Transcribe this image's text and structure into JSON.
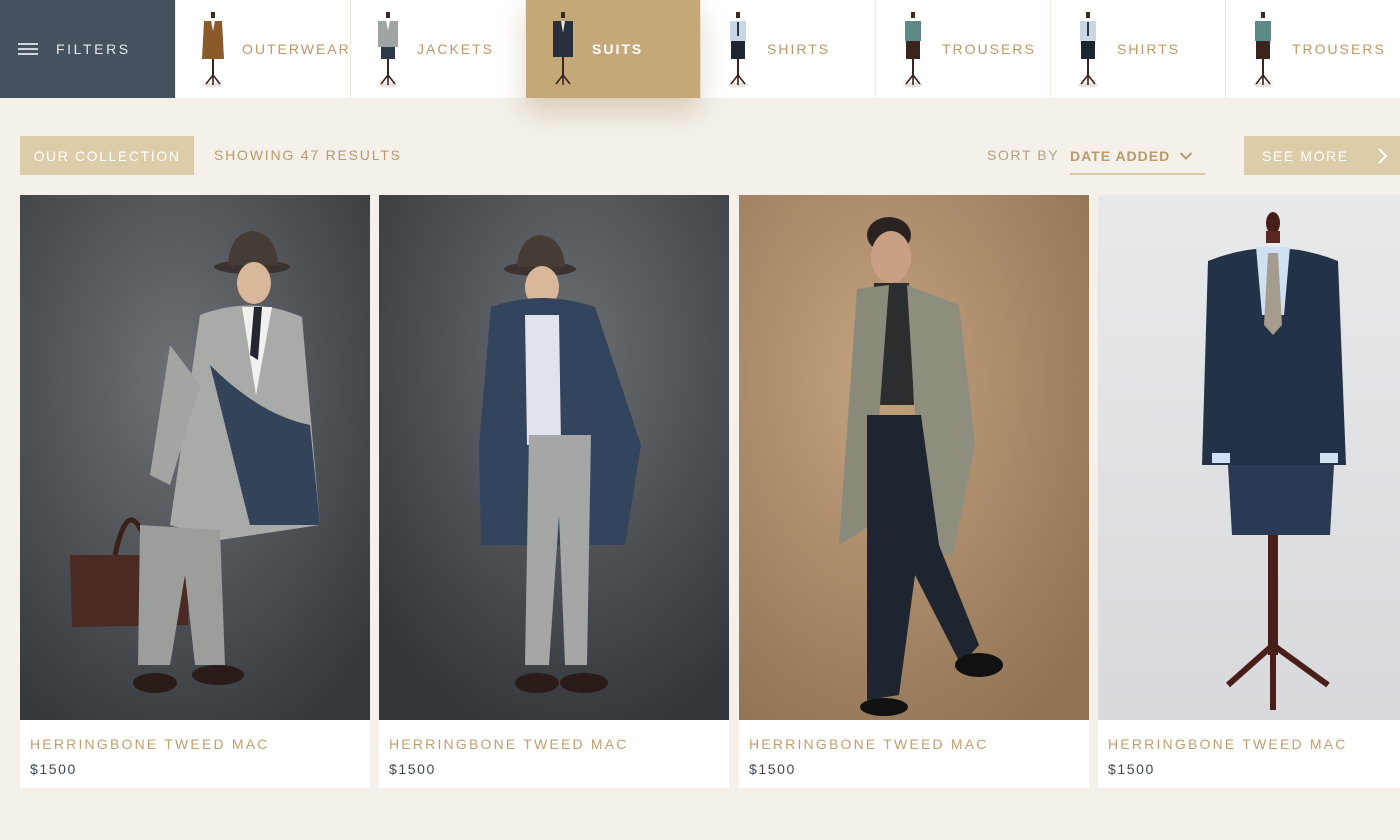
{
  "filters": {
    "label": "FILTERS",
    "icon": "filters-sliders-icon"
  },
  "categories": [
    {
      "label": "OUTERWEAR",
      "active": false
    },
    {
      "label": "JACKETS",
      "active": false
    },
    {
      "label": "SUITS",
      "active": true
    },
    {
      "label": "SHIRTS",
      "active": false
    },
    {
      "label": "TROUSERS",
      "active": false
    },
    {
      "label": "SHIRTS",
      "active": false
    },
    {
      "label": "TROUSERS",
      "active": false
    }
  ],
  "toolbar": {
    "collection_label": "OUR COLLECTION",
    "results_text": "SHOWING 47 RESULTS",
    "sort_label": "SORT BY",
    "sort_value": "DATE ADDED",
    "see_more_label": "SEE MORE"
  },
  "products": [
    {
      "title": "HERRINGBONE TWEED MAC",
      "price": "$1500"
    },
    {
      "title": "HERRINGBONE TWEED MAC",
      "price": "$1500"
    },
    {
      "title": "HERRINGBONE TWEED MAC",
      "price": "$1500"
    },
    {
      "title": "HERRINGBONE TWEED MAC",
      "price": "$1500"
    }
  ],
  "colors": {
    "accent_gold": "#c4a878",
    "filters_bg": "#46525e",
    "page_bg": "#f5f1ea",
    "button_bg": "#ddcca9",
    "price_text": "#3f4852"
  }
}
